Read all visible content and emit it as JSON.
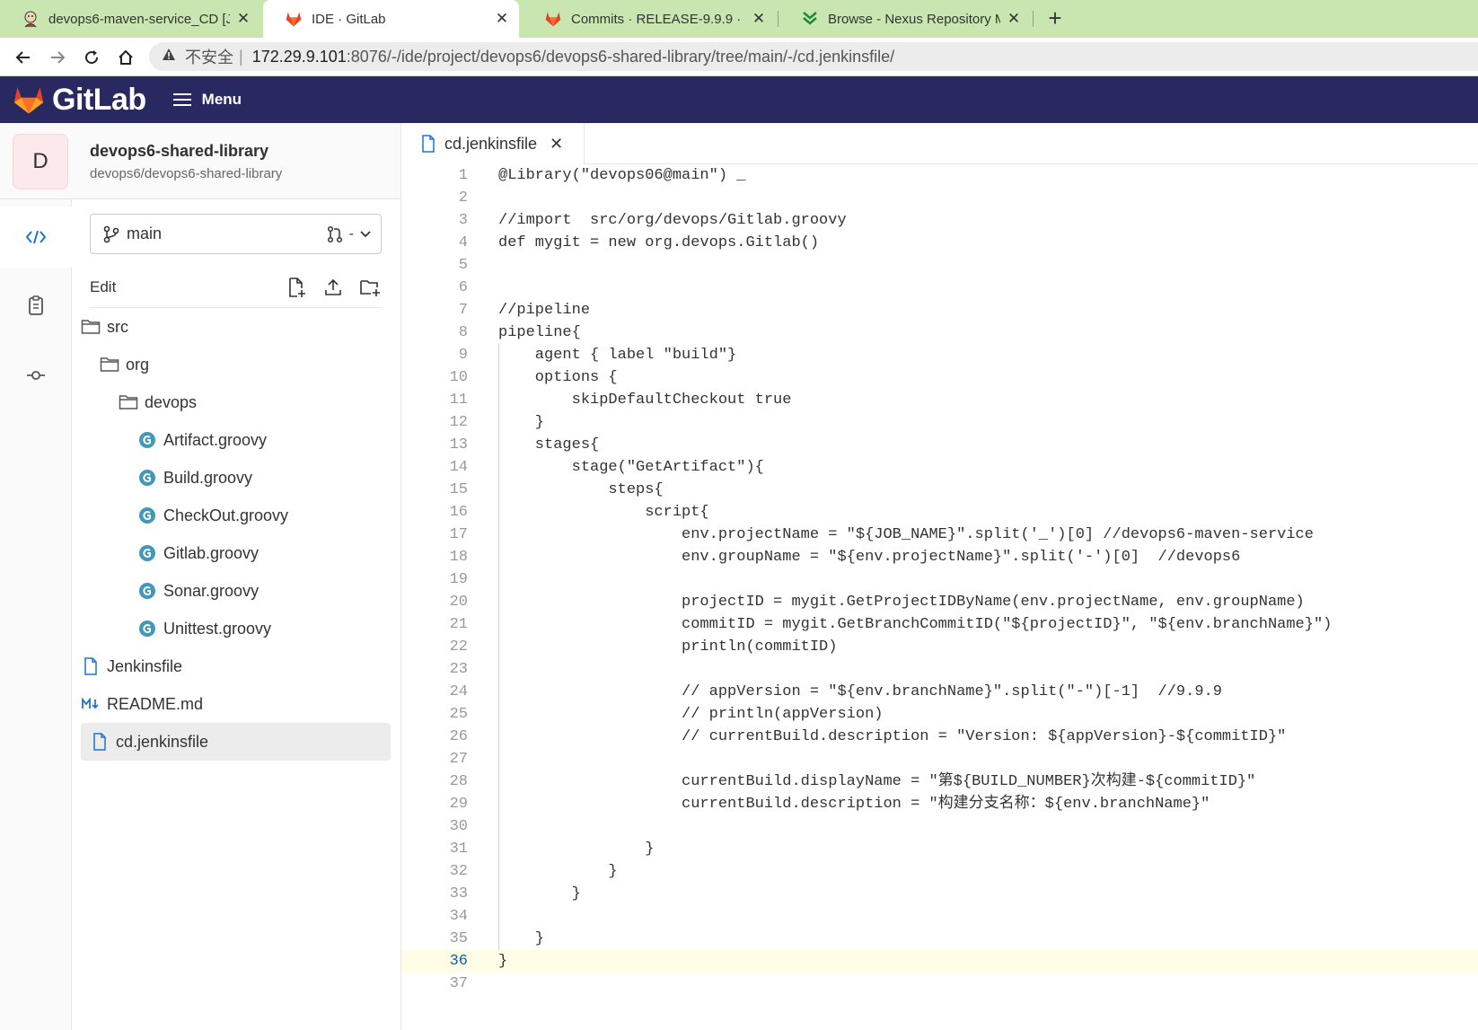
{
  "browser": {
    "tabs": [
      {
        "title": "devops6-maven-service_CD [Je",
        "icon": "jenkins-icon"
      },
      {
        "title": "IDE · GitLab",
        "icon": "gitlab-icon"
      },
      {
        "title": "Commits · RELEASE-9.9.9 · dev",
        "icon": "gitlab-icon"
      },
      {
        "title": "Browse - Nexus Repository Ma",
        "icon": "nexus-icon"
      }
    ],
    "new_tab": "+",
    "close": "✕",
    "insecure_label": "不安全",
    "separator": "|",
    "url_host": "172.29.9.101",
    "url_path": ":8076/-/ide/project/devops6/devops6-shared-library/tree/main/-/cd.jenkinsfile/"
  },
  "header": {
    "brand": "GitLab",
    "menu_label": "Menu"
  },
  "project": {
    "avatar_letter": "D",
    "name": "devops6-shared-library",
    "path": "devops6/devops6-shared-library"
  },
  "tree": {
    "branch": "main",
    "mr_label": "-",
    "edit_label": "Edit",
    "items": [
      {
        "name": "src",
        "type": "folder"
      },
      {
        "name": "org",
        "type": "folder"
      },
      {
        "name": "devops",
        "type": "folder"
      },
      {
        "name": "Artifact.groovy",
        "type": "groovy"
      },
      {
        "name": "Build.groovy",
        "type": "groovy"
      },
      {
        "name": "CheckOut.groovy",
        "type": "groovy"
      },
      {
        "name": "Gitlab.groovy",
        "type": "groovy"
      },
      {
        "name": "Sonar.groovy",
        "type": "groovy"
      },
      {
        "name": "Unittest.groovy",
        "type": "groovy"
      },
      {
        "name": "Jenkinsfile",
        "type": "file"
      },
      {
        "name": "README.md",
        "type": "markdown"
      },
      {
        "name": "cd.jenkinsfile",
        "type": "file",
        "active": true
      }
    ]
  },
  "editor": {
    "tab_label": "cd.jenkinsfile",
    "tab_close": "✕",
    "current_line": 36,
    "lines": [
      "@Library(\"devops06@main\") _",
      "",
      "//import  src/org/devops/Gitlab.groovy",
      "def mygit = new org.devops.Gitlab()",
      "",
      "",
      "//pipeline",
      "pipeline{",
      "    agent { label \"build\"}",
      "    options {",
      "        skipDefaultCheckout true",
      "    }",
      "    stages{",
      "        stage(\"GetArtifact\"){",
      "            steps{",
      "                script{",
      "                    env.projectName = \"${JOB_NAME}\".split('_')[0] //devops6-maven-service",
      "                    env.groupName = \"${env.projectName}\".split('-')[0]  //devops6",
      "",
      "                    projectID = mygit.GetProjectIDByName(env.projectName, env.groupName)",
      "                    commitID = mygit.GetBranchCommitID(\"${projectID}\", \"${env.branchName}\")",
      "                    println(commitID)",
      "",
      "                    // appVersion = \"${env.branchName}\".split(\"-\")[-1]  //9.9.9",
      "                    // println(appVersion)",
      "                    // currentBuild.description = \"Version: ${appVersion}-${commitID}\"",
      "",
      "                    currentBuild.displayName = \"第${BUILD_NUMBER}次构建-${commitID}\"",
      "                    currentBuild.description = \"构建分支名称：${env.branchName}\"",
      "",
      "                }",
      "            }",
      "        }",
      "",
      "    }",
      "}",
      ""
    ]
  }
}
